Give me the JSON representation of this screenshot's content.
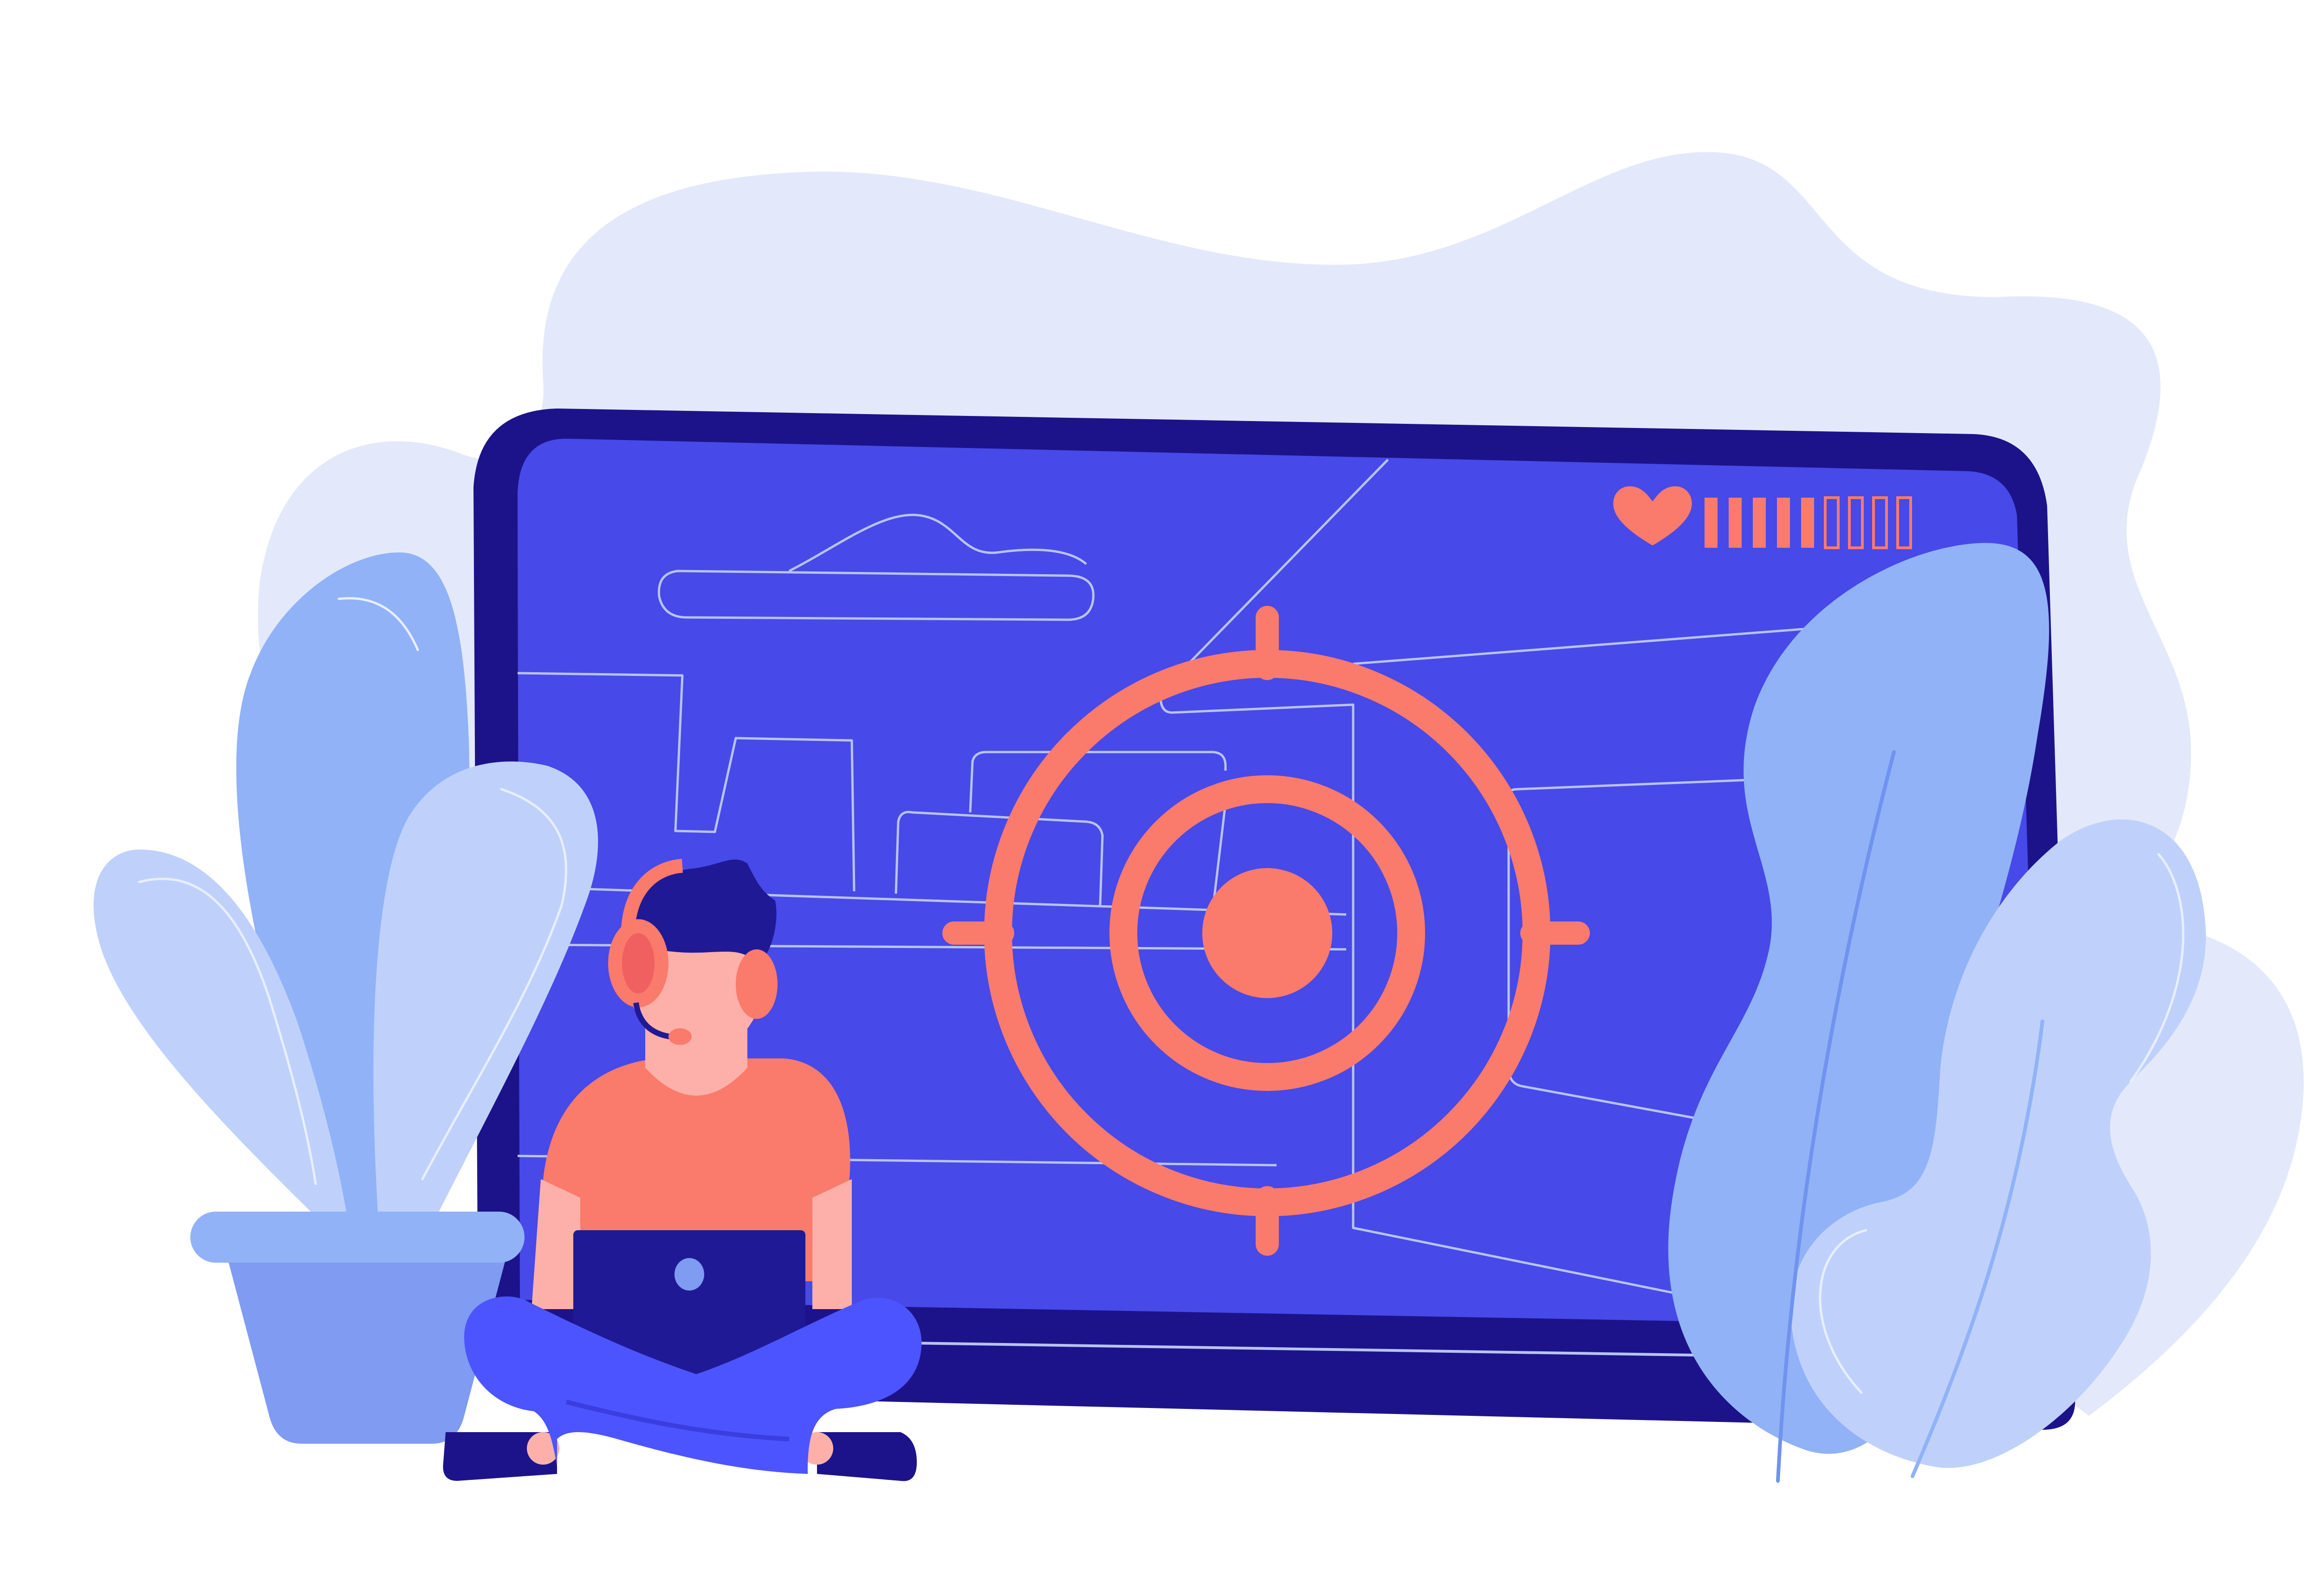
{
  "colors": {
    "background": "#ffffff",
    "blob": "#e3e9fa",
    "monitor_frame": "#1c138a",
    "monitor_screen": "#4749e8",
    "screen_lines": "#b9c3f5",
    "accent": "#fa7a6c",
    "leaf_dark": "#91b2f7",
    "leaf_light": "#bfd1fb",
    "pot": "#7f9bf2",
    "pot_rim": "#91b2f7",
    "shirt": "#fa7a6c",
    "skin": "#fdb0a9",
    "hair": "#201995",
    "legs": "#4c54ff",
    "laptop": "#201995",
    "shoes": "#1c138a"
  },
  "hud": {
    "icon": "heart-icon",
    "health_total": 9,
    "health_filled": 5
  },
  "crosshair": {
    "icon": "crosshair-icon"
  }
}
